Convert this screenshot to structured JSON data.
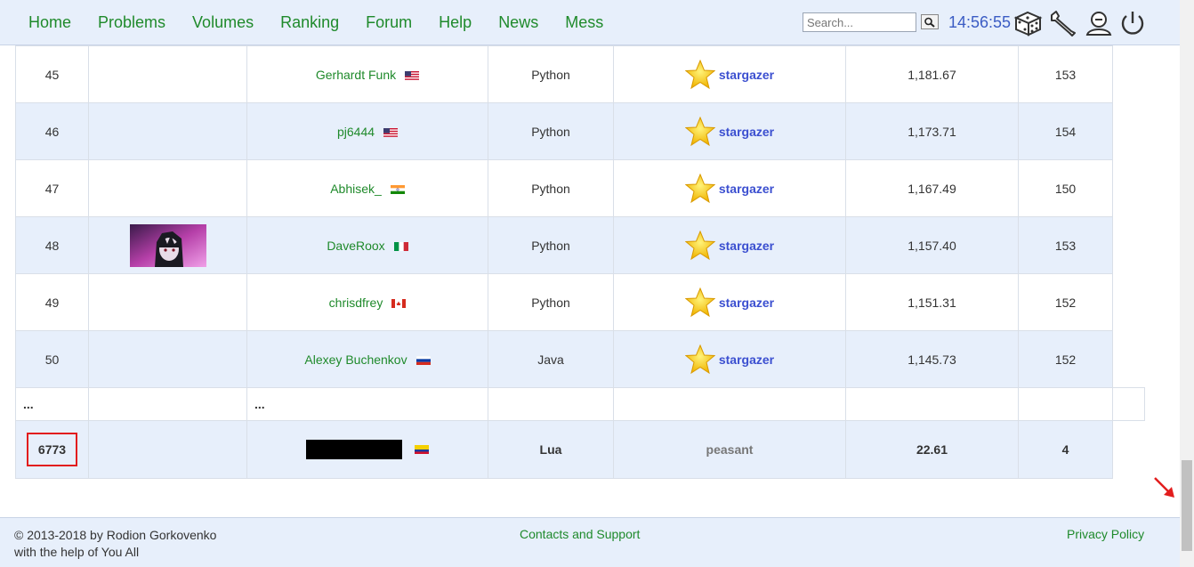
{
  "nav": {
    "home": "Home",
    "problems": "Problems",
    "volumes": "Volumes",
    "ranking": "Ranking",
    "forum": "Forum",
    "help": "Help",
    "news": "News",
    "mess": "Mess",
    "search_placeholder": "Search...",
    "clock": "14:56:55"
  },
  "rows": [
    {
      "pos": "45",
      "name": "Gerhardt Funk",
      "flag": "us",
      "lang": "Python",
      "rank": "stargazer",
      "score": "1,181.67",
      "solved": "153"
    },
    {
      "pos": "46",
      "name": "pj6444",
      "flag": "us",
      "lang": "Python",
      "rank": "stargazer",
      "score": "1,173.71",
      "solved": "154"
    },
    {
      "pos": "47",
      "name": "Abhisek_",
      "flag": "in",
      "lang": "Python",
      "rank": "stargazer",
      "score": "1,167.49",
      "solved": "150"
    },
    {
      "pos": "48",
      "name": "DaveRoox",
      "flag": "it",
      "lang": "Python",
      "rank": "stargazer",
      "score": "1,157.40",
      "solved": "153"
    },
    {
      "pos": "49",
      "name": "chrisdfrey",
      "flag": "ca",
      "lang": "Python",
      "rank": "stargazer",
      "score": "1,151.31",
      "solved": "152"
    },
    {
      "pos": "50",
      "name": "Alexey Buchenkov",
      "flag": "ru",
      "lang": "Java",
      "rank": "stargazer",
      "score": "1,145.73",
      "solved": "152"
    }
  ],
  "ellipsis": "...",
  "me": {
    "pos": "6773",
    "flag": "co",
    "lang": "Lua",
    "rank": "peasant",
    "score": "22.61",
    "solved": "4"
  },
  "footer": {
    "copy1": "© 2013-2018 by Rodion Gorkovenko",
    "copy2": "with the help of You All",
    "contacts": "Contacts and Support",
    "privacy": "Privacy Policy"
  },
  "colors": {
    "accent_green": "#1f8a2b",
    "rank_blue": "#3b4fd0",
    "row_alt": "#e7effb",
    "highlight_red": "#e21d1d"
  },
  "icons": [
    "search-icon",
    "dice-icon",
    "wrench-icon",
    "user-icon",
    "power-icon",
    "star-icon",
    "flag-icon"
  ]
}
